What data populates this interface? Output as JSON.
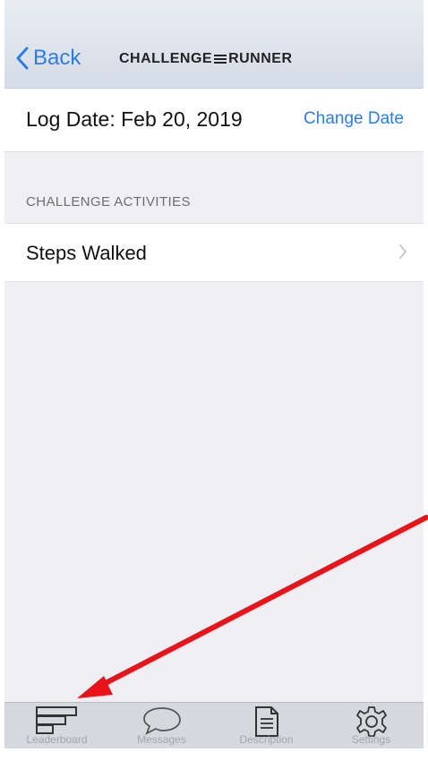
{
  "navbar": {
    "back_label": "Back",
    "brand_left": "CHALLENGE",
    "brand_right": "RUNNER"
  },
  "log": {
    "date_text": "Log Date: Feb 20, 2019",
    "change_label": "Change Date"
  },
  "activities": {
    "header": "CHALLENGE ACTIVITIES",
    "items": [
      {
        "label": "Steps Walked"
      }
    ]
  },
  "tabbar": {
    "tabs": [
      {
        "label": "Leaderboard",
        "icon": "leaderboard-icon"
      },
      {
        "label": "Messages",
        "icon": "messages-icon"
      },
      {
        "label": "Description",
        "icon": "description-icon"
      },
      {
        "label": "Settings",
        "icon": "settings-icon"
      }
    ]
  },
  "colors": {
    "accent": "#2f7ce0",
    "annotation_arrow": "#e8141a",
    "background": "#efeff4"
  }
}
